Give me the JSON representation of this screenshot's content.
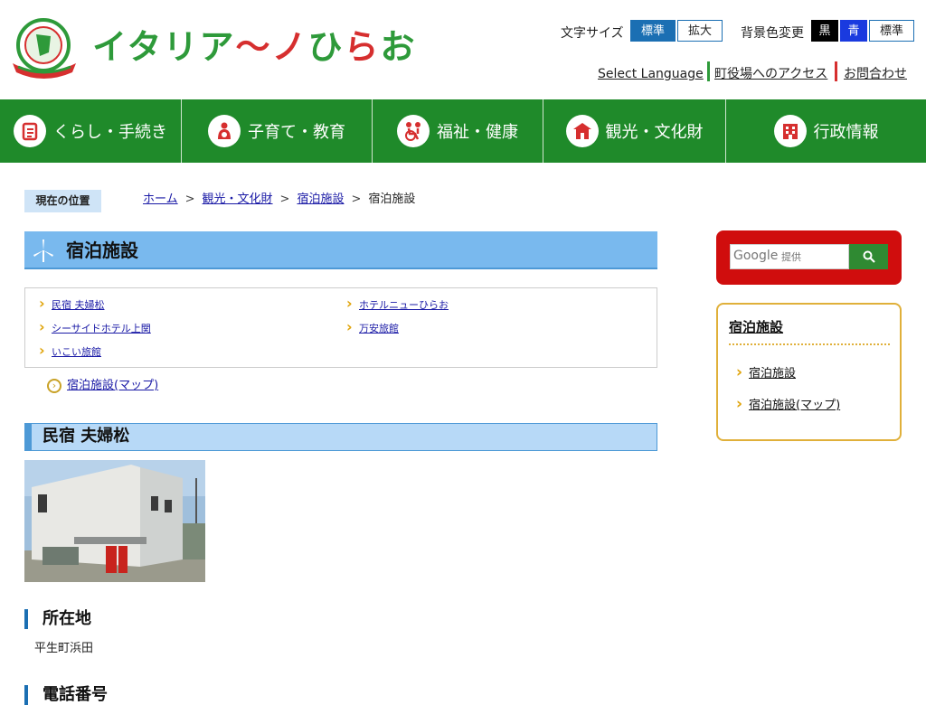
{
  "header": {
    "logo_text": "イタリア〜ノひらお",
    "font_size_label": "文字サイズ",
    "font_size_options": [
      "標準",
      "拡大"
    ],
    "bg_color_label": "背景色変更",
    "bg_color_options": [
      "黒",
      "青",
      "標準"
    ],
    "util_links": [
      "Select Language",
      "町役場へのアクセス",
      "お問合わせ"
    ]
  },
  "nav": {
    "items": [
      {
        "label": "くらし・手続き",
        "icon": "clipboard-icon"
      },
      {
        "label": "子育て・教育",
        "icon": "parent-child-icon"
      },
      {
        "label": "福祉・健康",
        "icon": "wheelchair-icon"
      },
      {
        "label": "観光・文化財",
        "icon": "temple-icon"
      },
      {
        "label": "行政情報",
        "icon": "building-icon"
      }
    ]
  },
  "breadcrumb": {
    "label": "現在の位置",
    "items": [
      "ホーム",
      "観光・文化財",
      "宿泊施設"
    ],
    "current": "宿泊施設"
  },
  "page": {
    "title": "宿泊施設",
    "index_links": [
      "民宿 夫婦松",
      "ホテルニューひらお",
      "シーサイドホテル上関",
      "万安旅館",
      "いこい旅館"
    ],
    "map_link": "宿泊施設(マップ)",
    "section_title": "民宿 夫婦松",
    "location_heading": "所在地",
    "location_value": "平生町浜田",
    "phone_heading": "電話番号"
  },
  "sidebar": {
    "search_watermark": "Google",
    "search_placeholder": "提供",
    "menu_title": "宿泊施設",
    "menu_items": [
      "宿泊施設",
      "宿泊施設(マップ)"
    ]
  },
  "colors": {
    "nav_green": "#1f8a2a",
    "title_blue": "#79b9ee",
    "accent_red": "#d00d0d",
    "accent_gold": "#e0b03a"
  }
}
